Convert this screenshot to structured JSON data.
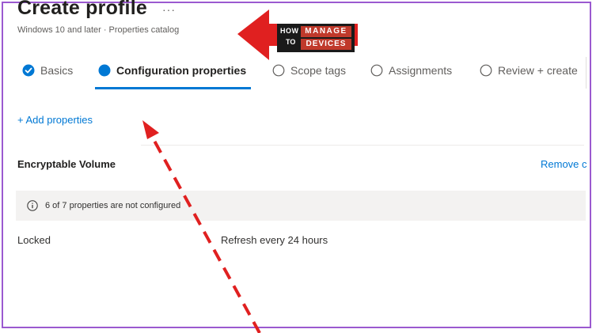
{
  "page": {
    "title": "Create profile",
    "more_label": "···",
    "subtitle": "Windows 10 and later · Properties catalog"
  },
  "steps": [
    {
      "label": "Basics",
      "state": "completed"
    },
    {
      "label": "Configuration properties",
      "state": "active"
    },
    {
      "label": "Scope tags",
      "state": "pending"
    },
    {
      "label": "Assignments",
      "state": "pending"
    },
    {
      "label": "Review + create",
      "state": "pending"
    }
  ],
  "actions": {
    "add_properties": "+ Add properties"
  },
  "section": {
    "title": "Encryptable Volume",
    "remove_label": "Remove c"
  },
  "info_bar": {
    "text": "6 of 7 properties are not configured",
    "icon": "info-icon"
  },
  "property": {
    "name": "Locked",
    "value": "Refresh every 24 hours"
  },
  "logo": {
    "how": "HOW",
    "to": "TO",
    "manage": "MANAGE",
    "devices": "DEVICES"
  },
  "colors": {
    "accent": "#0078d4",
    "annotation_red": "#e02020",
    "frame_purple": "#9b59d0"
  }
}
